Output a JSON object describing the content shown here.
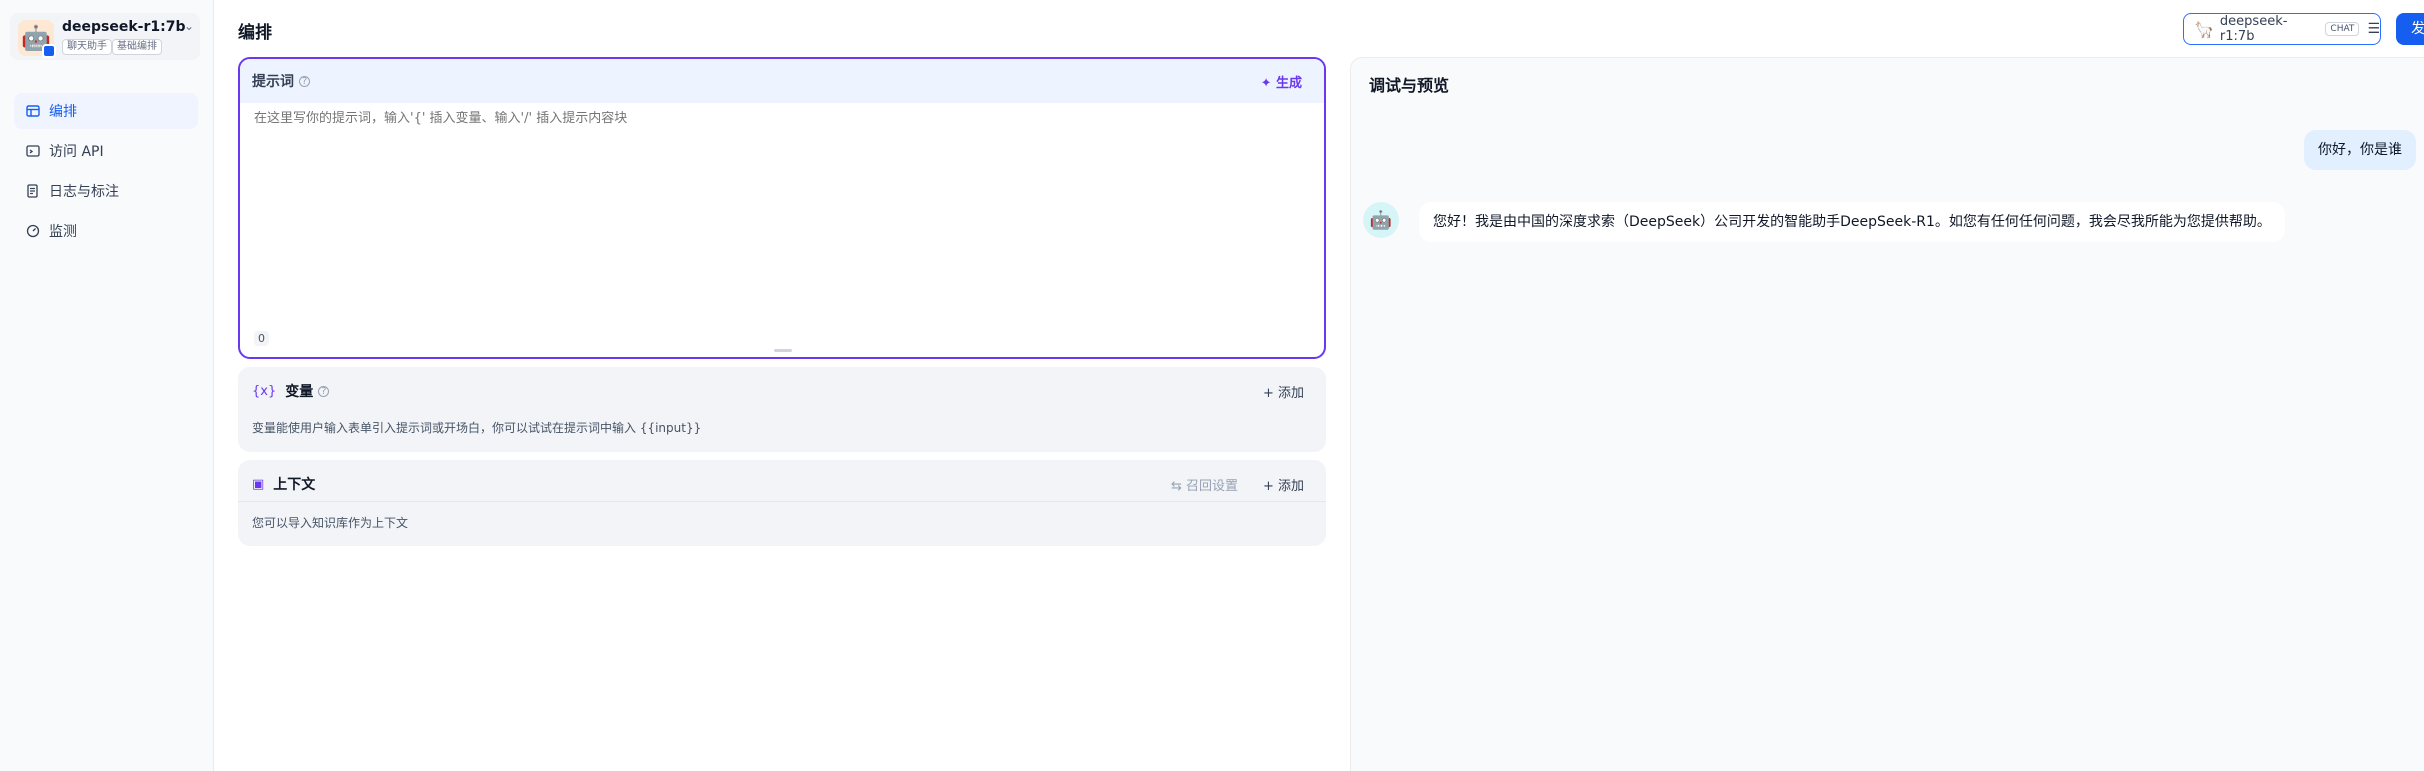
{
  "app": {
    "name": "deepseek-r1:7b",
    "tags": [
      "聊天助手",
      "基础编排"
    ]
  },
  "sidebar": {
    "items": [
      {
        "label": "编排",
        "icon": "layout-icon",
        "active": true
      },
      {
        "label": "访问 API",
        "icon": "terminal-icon",
        "active": false
      },
      {
        "label": "日志与标注",
        "icon": "log-icon",
        "active": false
      },
      {
        "label": "监测",
        "icon": "gauge-icon",
        "active": false
      }
    ]
  },
  "header": {
    "title": "编排",
    "model_name": "deepseek-r1:7b",
    "model_chip": "CHAT",
    "publish_label": "发"
  },
  "prompt": {
    "title": "提示词",
    "generate_label": "生成",
    "placeholder": "在这里写你的提示词，输入'{' 插入变量、输入'/' 插入提示内容块",
    "count": "0"
  },
  "variables": {
    "title": "变量",
    "add_label": "添加",
    "description": "变量能使用户输入表单引入提示词或开场白，你可以试试在提示词中输入 {{input}}"
  },
  "context": {
    "title": "上下文",
    "recall_label": "召回设置",
    "add_label": "添加",
    "description": "您可以导入知识库作为上下文"
  },
  "preview": {
    "title": "调试与预览",
    "user_message": "你好，你是谁",
    "bot_message": "您好！我是由中国的深度求索（DeepSeek）公司开发的智能助手DeepSeek-R1。如您有任何任何问题，我会尽我所能为您提供帮助。"
  },
  "colors": {
    "accent": "#155eef",
    "prompt_border": "#6938ef"
  }
}
